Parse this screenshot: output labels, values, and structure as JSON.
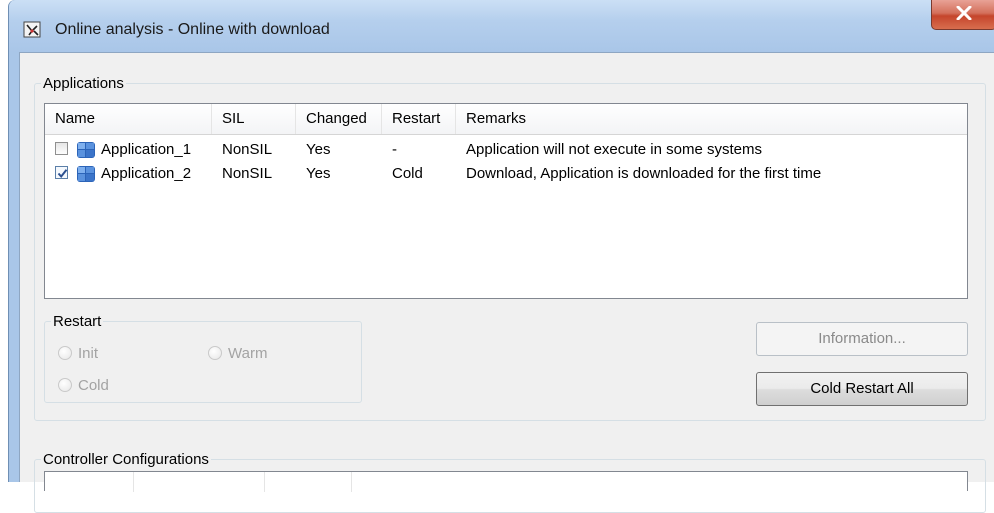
{
  "window": {
    "title": "Online analysis - Online with download",
    "close_label": "X"
  },
  "applications": {
    "group_label": "Applications",
    "columns": [
      "Name",
      "SIL",
      "Changed",
      "Restart",
      "Remarks"
    ],
    "rows": [
      {
        "checked": false,
        "name": "Application_1",
        "sil": "NonSIL",
        "changed": "Yes",
        "restart": "-",
        "remarks": "Application will not execute in some systems"
      },
      {
        "checked": true,
        "name": "Application_2",
        "sil": "NonSIL",
        "changed": "Yes",
        "restart": "Cold",
        "remarks": "Download, Application is downloaded for the first time"
      }
    ]
  },
  "restart": {
    "group_label": "Restart",
    "options": {
      "init": "Init",
      "warm": "Warm",
      "cold": "Cold"
    }
  },
  "buttons": {
    "information": "Information...",
    "cold_restart_all": "Cold Restart All"
  },
  "controller": {
    "group_label": "Controller Configurations"
  },
  "colors": {
    "title_bar": "#a9c6e8",
    "close_button": "#c5452c",
    "client_bg": "#f0f0f0"
  }
}
